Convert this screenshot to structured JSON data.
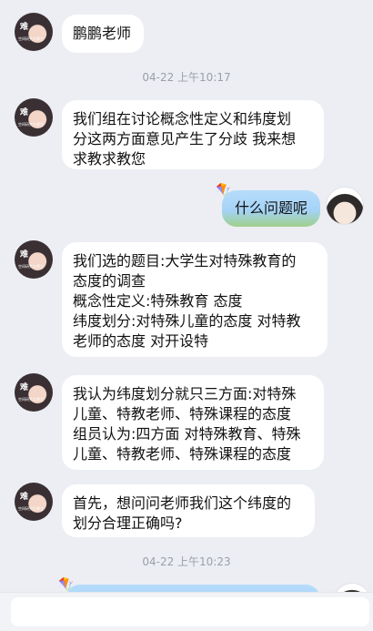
{
  "messages": [
    {
      "side": "left",
      "text": "鹏鹏老师"
    },
    {
      "side": "left",
      "text": "我们组在讨论概念性定义和纬度划\n分这两方面意见产生了分歧  我来想\n求教求教您"
    },
    {
      "side": "right",
      "text": "什么问题呢"
    },
    {
      "side": "left",
      "text": "我们选的题目:大学生对特殊教育的\n态度的调查\n概念性定义:特殊教育  态度\n纬度划分:对特殊儿童的态度  对特教\n老师的态度 对开设特"
    },
    {
      "side": "left",
      "text": "我认为纬度划分就只三方面:对特殊\n儿童、特教老师、特殊课程的态度\n组员认为:四方面 对特殊教育、特殊\n儿童、特教老师、特殊课程的态度"
    },
    {
      "side": "left",
      "text": "首先，想问问老师我们这个纬度的\n划分合理正确吗?"
    }
  ],
  "timestamps": [
    "04-22 上午10:17",
    "04-22 上午10:23"
  ],
  "avatar_badge": "难",
  "avatar_caption": "空间研究大师工"
}
